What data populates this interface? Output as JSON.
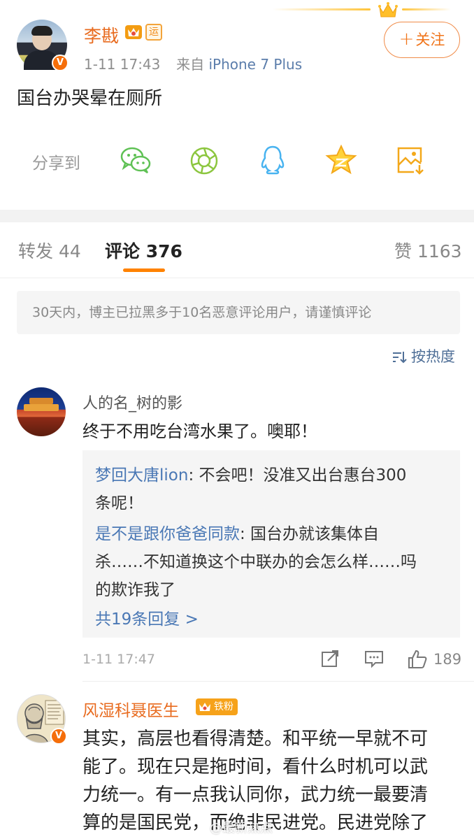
{
  "post": {
    "author": "李戡",
    "badge_text": "运",
    "time": "1-11 17:43",
    "source_prefix": "来自",
    "source": "iPhone 7 Plus",
    "follow_label": "关注",
    "text": "国台办哭晕在厕所",
    "share_label": "分享到",
    "share_icons": [
      "wechat-icon",
      "moments-icon",
      "qq-icon",
      "qzone-icon",
      "save-image-icon"
    ]
  },
  "tabs": {
    "repost_label": "转发",
    "repost_count": "44",
    "comment_label": "评论",
    "comment_count": "376",
    "likes_label": "赞",
    "likes_count": "1163"
  },
  "notice": "30天内，博主已拉黑多于10名恶意评论用户，请谨慎评论",
  "sort_label": "按热度",
  "comments": [
    {
      "user": "人的名_树的影",
      "text": "终于不用吃台湾水果了。噢耶！",
      "replies": [
        {
          "user": "梦回大唐lion",
          "line1": ": 不会吧！没准又出台惠台300",
          "line2": "条呢！"
        },
        {
          "user": "是不是跟你爸爸同款",
          "line1": ": 国台办就该集体自",
          "line2": "杀……不知道换这个中联办的会怎么样……吗",
          "line3": "的欺诈我了"
        }
      ],
      "more_replies": "共19条回复 >",
      "time": "1-11 17:47",
      "likes": "189"
    },
    {
      "user": "风湿科聂医生",
      "fan_badge": "铁粉",
      "lines": [
        "其实，高层也看得清楚。和平统一早就不可",
        "能了。现在只是拖时间，看什么时机可以武",
        "力统一。有一点我认同你，武力统一最要清",
        "算的是国民党，而绝非民进党。民进党除了"
      ]
    }
  ],
  "watermark": "@最新热点",
  "colors": {
    "accent_orange": "#ff8200",
    "name_orange": "#e86b1f",
    "link_blue": "#4a78b5",
    "verified_badge": "#f56e0a"
  }
}
